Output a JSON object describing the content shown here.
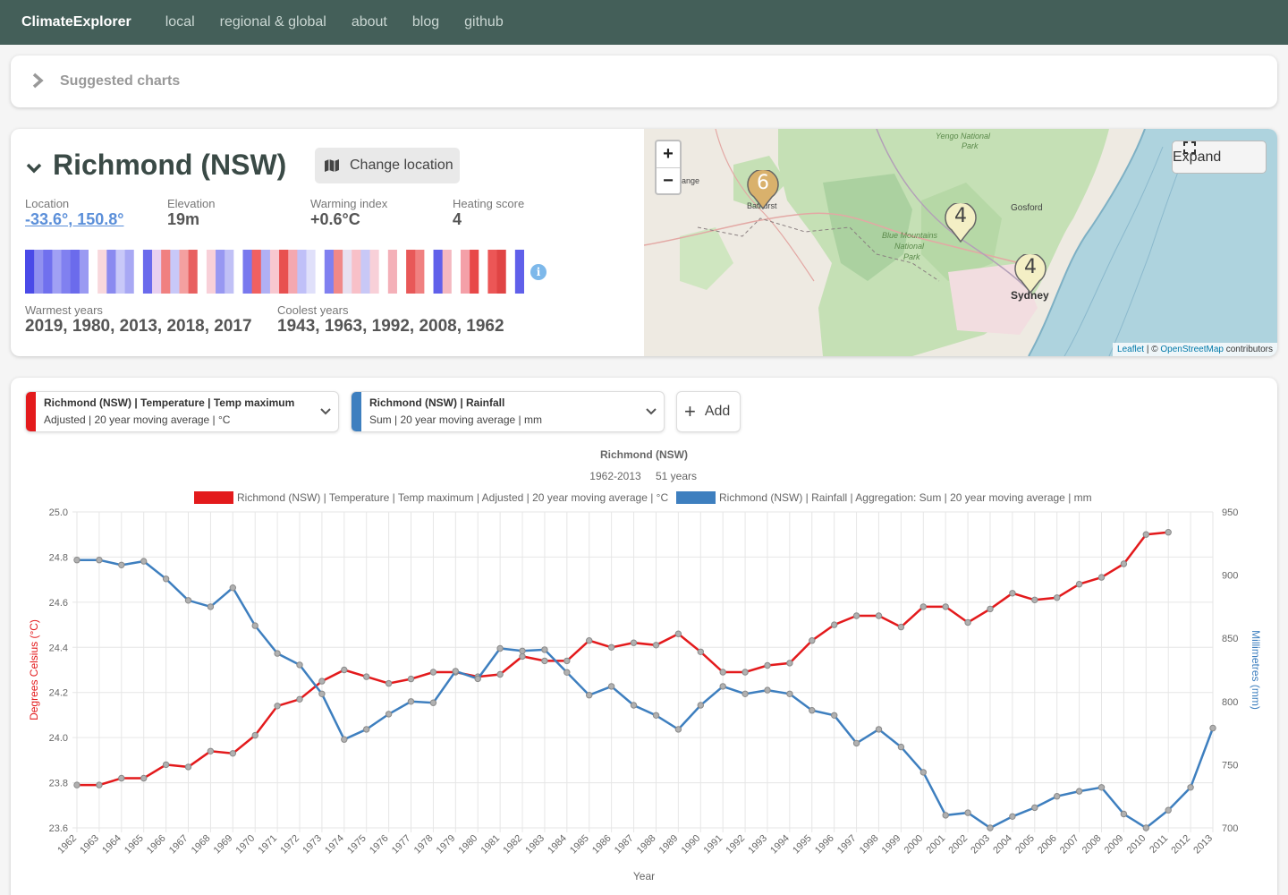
{
  "nav": {
    "brand": "ClimateExplorer",
    "links": [
      "local",
      "regional & global",
      "about",
      "blog",
      "github"
    ]
  },
  "suggested": {
    "label": "Suggested charts"
  },
  "location": {
    "name": "Richmond (NSW)",
    "change_label": "Change location",
    "stats": [
      {
        "label": "Location",
        "value": "-33.6°, 150.8°"
      },
      {
        "label": "Elevation",
        "value": "19m"
      },
      {
        "label": "Warming index",
        "value": "+0.6°C"
      },
      {
        "label": "Heating score",
        "value": "4"
      }
    ],
    "warmest_label": "Warmest years",
    "warmest_value": "2019, 1980, 2013, 2018, 2017",
    "coolest_label": "Coolest years",
    "coolest_value": "1943, 1963, 1992, 2008, 1962",
    "info_icon": "i"
  },
  "map": {
    "zoom_in": "+",
    "zoom_out": "−",
    "expand_label": "Expand",
    "attribution_leaflet": "Leaflet",
    "attribution_sep": " | © ",
    "attribution_osm": "OpenStreetMap",
    "attribution_tail": " contributors",
    "places": [
      "Yengo National",
      "Park",
      "ange",
      "Bathurst",
      "Gosford",
      "Blue Mountains",
      "National",
      "Park",
      "Sydney"
    ],
    "clusters": [
      {
        "count": "6",
        "color": "#d9b16c"
      },
      {
        "count": "4",
        "color": "#f4efc5"
      },
      {
        "count": "4",
        "color": "#f4efc5"
      }
    ]
  },
  "selectors": [
    {
      "line1": "Richmond (NSW) | Temperature | Temp maximum",
      "line2": "Adjusted | 20 year moving average | °C",
      "color": "#e31a1c"
    },
    {
      "line1": "Richmond (NSW) | Rainfall",
      "line2": "Sum | 20 year moving average | mm",
      "color": "#3e7fbf"
    }
  ],
  "add_label": "Add",
  "chart_data": {
    "type": "line",
    "title": "Richmond (NSW)",
    "subtitle_range": "1962-2013",
    "subtitle_years": "51 years",
    "xlabel": "Year",
    "ylabel_left": "Degrees Celsius (°C)",
    "ylabel_right": "Millimetres (mm)",
    "ylim_left": [
      23.6,
      25.0
    ],
    "ylim_right": [
      700,
      950
    ],
    "yticks_left": [
      "25.0",
      "24.8",
      "24.6",
      "24.4",
      "24.2",
      "24.0",
      "23.8",
      "23.6"
    ],
    "yticks_right": [
      "950",
      "900",
      "850",
      "800",
      "750",
      "700"
    ],
    "categories": [
      "1962",
      "1963",
      "1964",
      "1965",
      "1966",
      "1967",
      "1968",
      "1969",
      "1970",
      "1971",
      "1972",
      "1973",
      "1974",
      "1975",
      "1976",
      "1977",
      "1978",
      "1979",
      "1980",
      "1981",
      "1982",
      "1983",
      "1984",
      "1985",
      "1986",
      "1987",
      "1988",
      "1989",
      "1990",
      "1991",
      "1992",
      "1993",
      "1994",
      "1995",
      "1996",
      "1997",
      "1998",
      "1999",
      "2000",
      "2001",
      "2002",
      "2003",
      "2004",
      "2005",
      "2006",
      "2007",
      "2008",
      "2009",
      "2010",
      "2011",
      "2012",
      "2013"
    ],
    "series": [
      {
        "name": "Richmond (NSW) | Temperature | Temp maximum | Adjusted | 20 year moving average | °C",
        "color": "#e31a1c",
        "axis": "left",
        "values": [
          23.79,
          23.79,
          23.82,
          23.82,
          23.88,
          23.87,
          23.94,
          23.93,
          24.01,
          24.14,
          24.17,
          24.25,
          24.3,
          24.27,
          24.24,
          24.26,
          24.29,
          24.29,
          24.27,
          24.28,
          24.36,
          24.34,
          24.34,
          24.43,
          24.4,
          24.42,
          24.41,
          24.46,
          24.38,
          24.29,
          24.29,
          24.32,
          24.33,
          24.43,
          24.5,
          24.54,
          24.54,
          24.49,
          24.58,
          24.58,
          24.51,
          24.57,
          24.64,
          24.61,
          24.62,
          24.68,
          24.71,
          24.77,
          24.9,
          24.91,
          null,
          null
        ]
      },
      {
        "name": "Richmond (NSW) | Rainfall | Aggregation: Sum | 20 year moving average | mm",
        "color": "#3e7fbf",
        "axis": "right",
        "values": [
          912,
          912,
          908,
          911,
          897,
          880,
          875,
          890,
          860,
          838,
          829,
          806,
          770,
          778,
          790,
          800,
          799,
          824,
          818,
          842,
          840,
          841,
          823,
          805,
          812,
          797,
          789,
          778,
          797,
          812,
          806,
          809,
          806,
          793,
          789,
          767,
          778,
          764,
          744,
          710,
          712,
          700,
          709,
          716,
          725,
          729,
          732,
          711,
          700,
          714,
          732,
          779
        ]
      }
    ],
    "legend_position": "top",
    "grid": true
  }
}
